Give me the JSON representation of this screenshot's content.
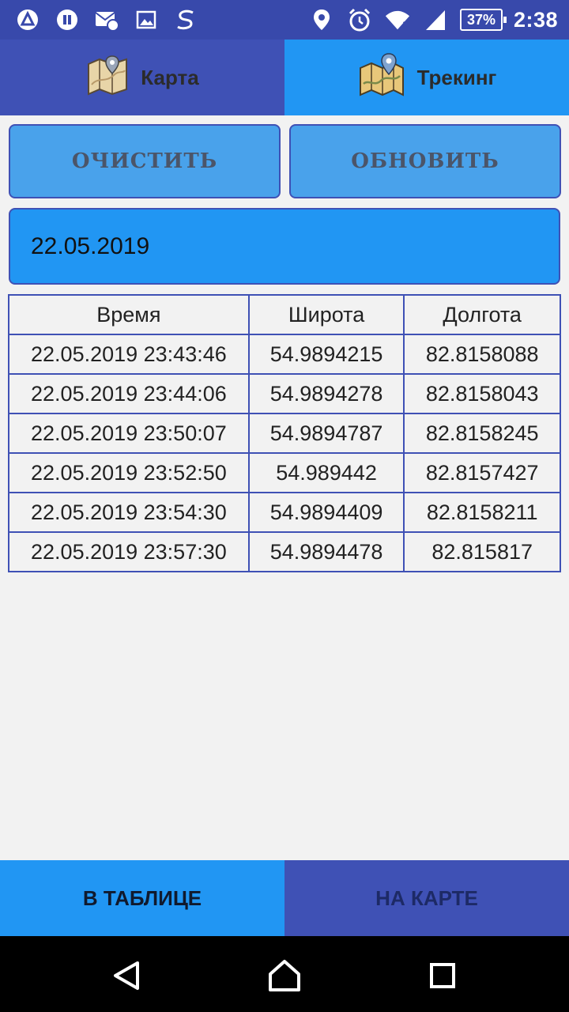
{
  "status_bar": {
    "battery": "37%",
    "time": "2:38"
  },
  "tabs": [
    {
      "label": "Карта",
      "icon": "map-icon"
    },
    {
      "label": "Трекинг",
      "icon": "map-pin-icon"
    }
  ],
  "actions": {
    "clear_label": "ОЧИСТИТЬ",
    "refresh_label": "ОБНОВИТЬ"
  },
  "date": "22.05.2019",
  "table": {
    "headers": [
      "Время",
      "Широта",
      "Долгота"
    ],
    "rows": [
      [
        "22.05.2019 23:43:46",
        "54.9894215",
        "82.8158088"
      ],
      [
        "22.05.2019 23:44:06",
        "54.9894278",
        "82.8158043"
      ],
      [
        "22.05.2019 23:50:07",
        "54.9894787",
        "82.8158245"
      ],
      [
        "22.05.2019 23:52:50",
        "54.989442",
        "82.8157427"
      ],
      [
        "22.05.2019 23:54:30",
        "54.9894409",
        "82.8158211"
      ],
      [
        "22.05.2019 23:57:30",
        "54.9894478",
        "82.815817"
      ]
    ]
  },
  "bottom_tabs": {
    "table_label": "В ТАБЛИЦЕ",
    "map_label": "НА КАРТЕ"
  },
  "colors": {
    "primary": "#3f51b5",
    "accent": "#2196f3",
    "button": "#49a2eb",
    "background": "#f2f2f2"
  }
}
